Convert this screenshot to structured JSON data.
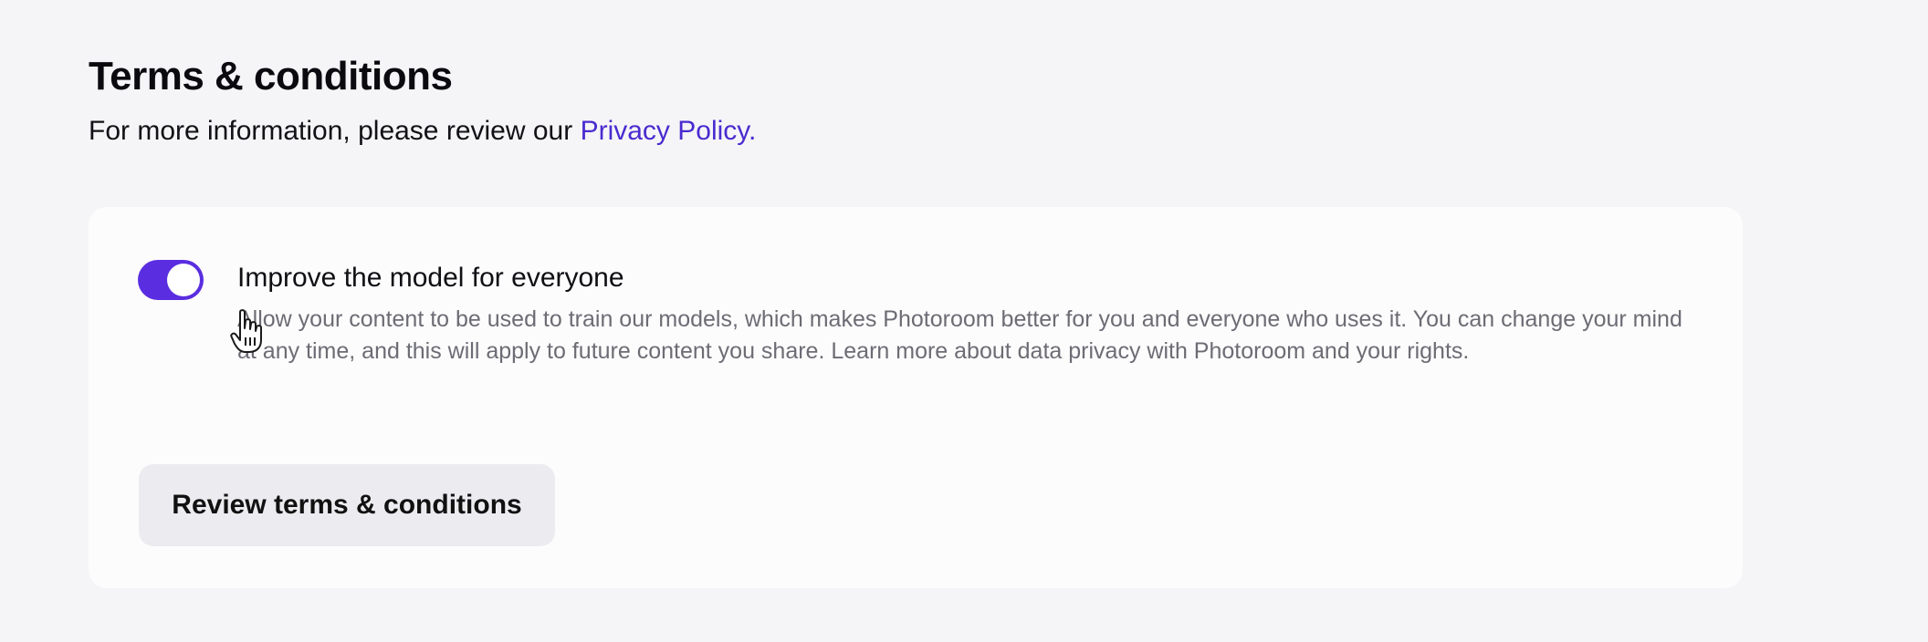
{
  "header": {
    "title": "Terms & conditions",
    "subtitle_prefix": "For more information, please review our",
    "privacy_link": "Privacy Policy."
  },
  "setting": {
    "toggle_state": "on",
    "title": "Improve the model for everyone",
    "description": "Allow your content to be used to train our models, which makes Photoroom better for you and everyone who uses it. You can change your mind at any time, and this will apply to future content you share. Learn more about data privacy with Photoroom and your rights."
  },
  "review_button": {
    "label": "Review terms & conditions"
  },
  "icons": {
    "cursor": "hand-pointer-icon"
  },
  "colors": {
    "accent": "#5a2ee0",
    "link": "#4a2bd0",
    "page_background": "#f5f5f7",
    "card_background": "#fcfcfd",
    "button_background": "#ececf0"
  }
}
